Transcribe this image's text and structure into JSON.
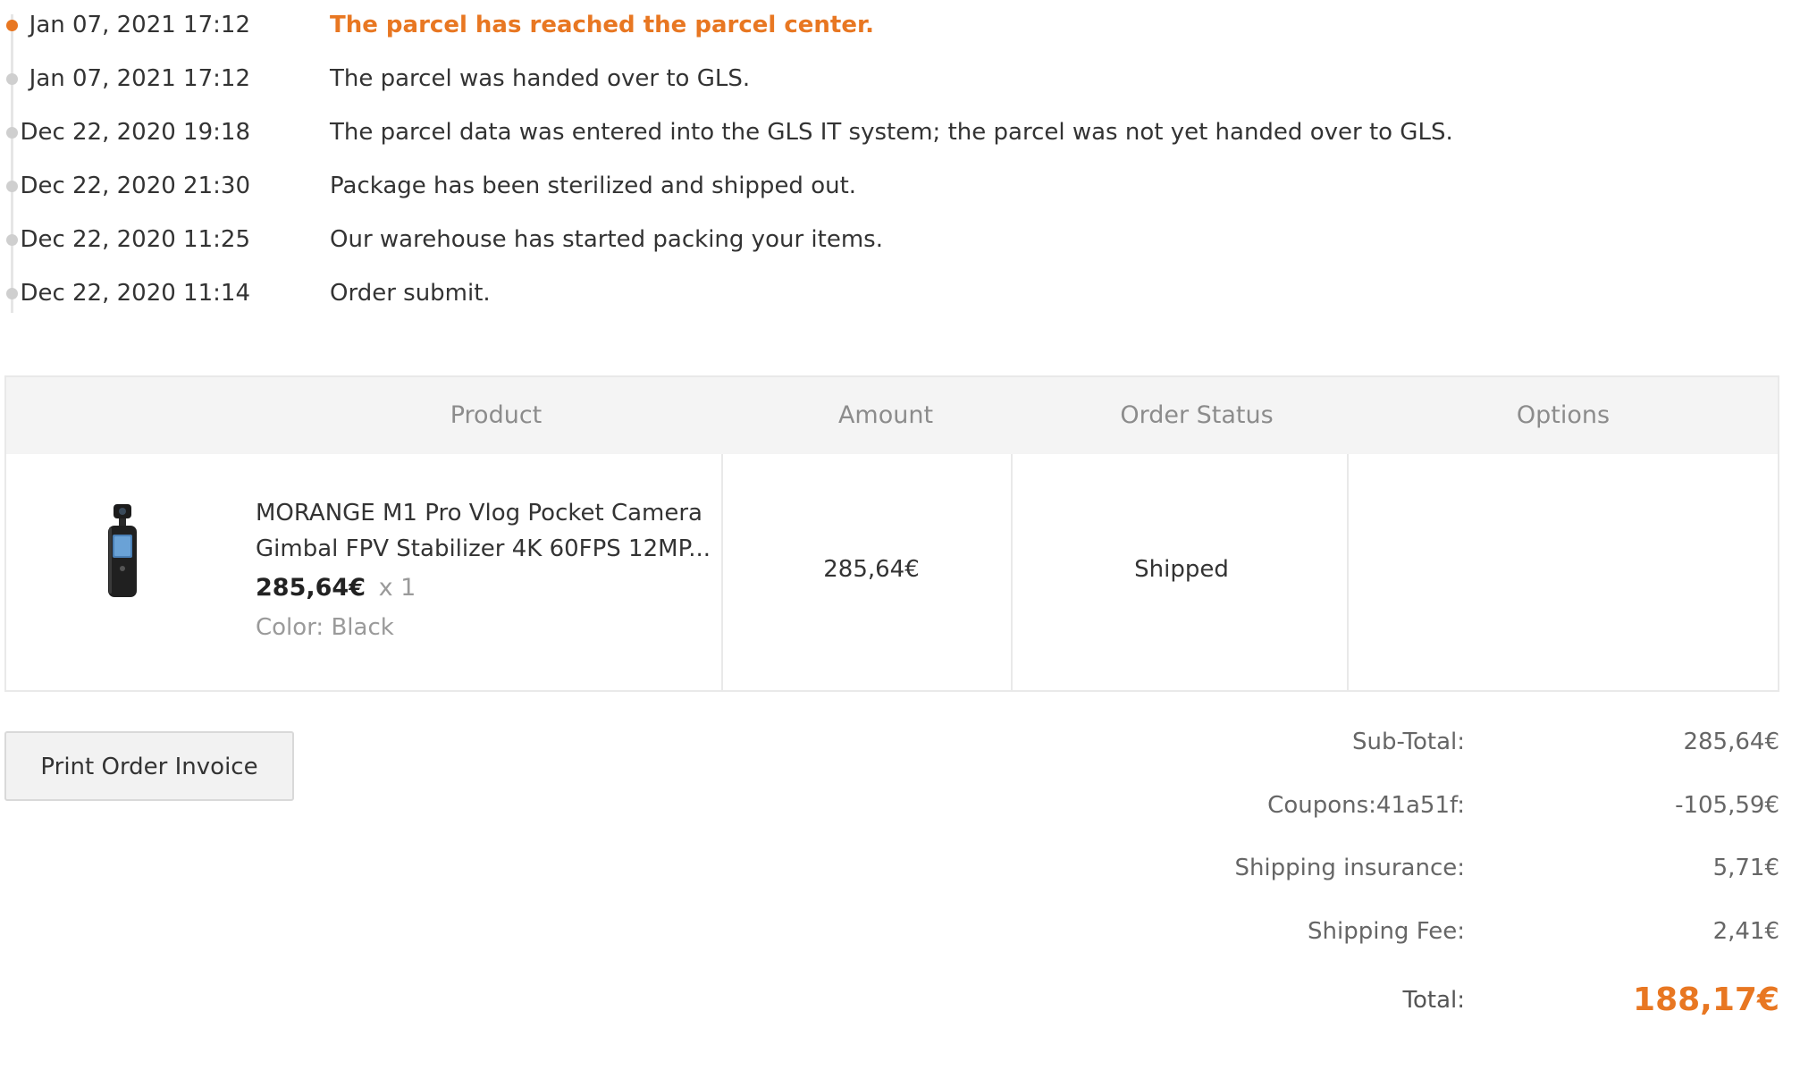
{
  "tracking": {
    "events": [
      {
        "time": "Jan 07, 2021 17:12",
        "description": "The parcel has reached the parcel center.",
        "current": true
      },
      {
        "time": "Jan 07, 2021 17:12",
        "description": "The parcel was handed over to GLS.",
        "current": false
      },
      {
        "time": "Dec 22, 2020 19:18",
        "description": "The parcel data was entered into the GLS IT system; the parcel was not yet handed over to GLS.",
        "current": false
      },
      {
        "time": "Dec 22, 2020 21:30",
        "description": "Package has been sterilized and shipped out.",
        "current": false
      },
      {
        "time": "Dec 22, 2020 11:25",
        "description": "Our warehouse has started packing your items.",
        "current": false
      },
      {
        "time": "Dec 22, 2020 11:14",
        "description": "Order submit.",
        "current": false
      }
    ]
  },
  "order_table": {
    "headers": {
      "product": "Product",
      "amount": "Amount",
      "status": "Order Status",
      "options": "Options"
    },
    "items": [
      {
        "image_icon": "pocket-camera-gimbal",
        "name": "MORANGE M1 Pro Vlog Pocket Camera Gimbal FPV Stabilizer 4K 60FPS 12MP...",
        "price": "285,64€",
        "quantity": "x 1",
        "color": "Color: Black",
        "amount": "285,64€",
        "status": "Shipped"
      }
    ]
  },
  "actions": {
    "print_invoice_label": "Print Order Invoice"
  },
  "totals": {
    "subtotal_label": "Sub-Total:",
    "subtotal_value": "285,64€",
    "coupon_label": "Coupons:41a51f:",
    "coupon_value": "-105,59€",
    "insurance_label": "Shipping insurance:",
    "insurance_value": "5,71€",
    "shipping_label": "Shipping Fee:",
    "shipping_value": "2,41€",
    "total_label": "Total:",
    "total_value": "188,17€"
  },
  "colors": {
    "accent": "#e87722",
    "muted_text": "#9a9a9a",
    "header_bg": "#f4f4f4",
    "border": "#e9e9e9"
  }
}
